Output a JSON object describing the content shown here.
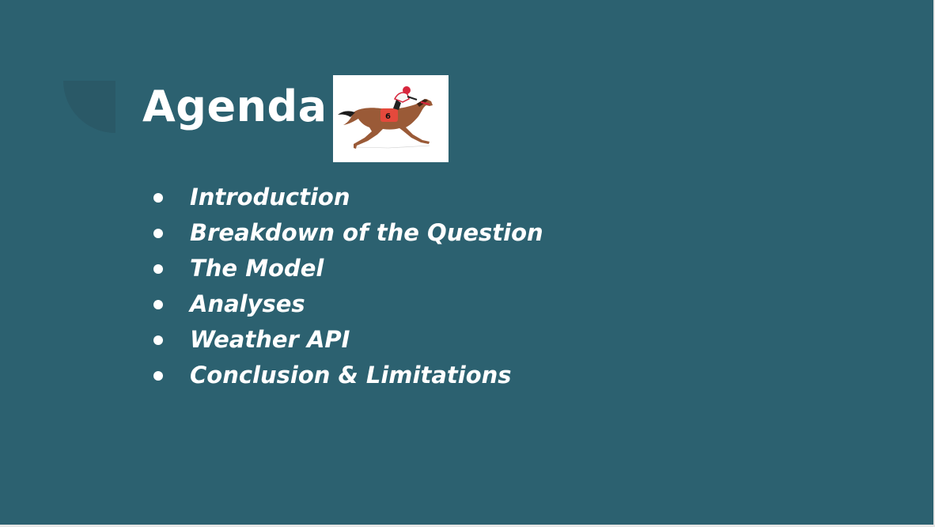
{
  "slide": {
    "title": "Agenda",
    "image": {
      "icon": "racehorse-jockey-icon",
      "number": "6"
    },
    "items": [
      {
        "label": "Introduction"
      },
      {
        "label": "Breakdown of the Question"
      },
      {
        "label": "The Model"
      },
      {
        "label": "Analyses"
      },
      {
        "label": "Weather API"
      },
      {
        "label": "Conclusion & Limitations"
      }
    ]
  },
  "colors": {
    "background": "#2c6170",
    "text": "#ffffff",
    "horse": "#9a5a37",
    "saddle_cloth": "#e5493c"
  }
}
